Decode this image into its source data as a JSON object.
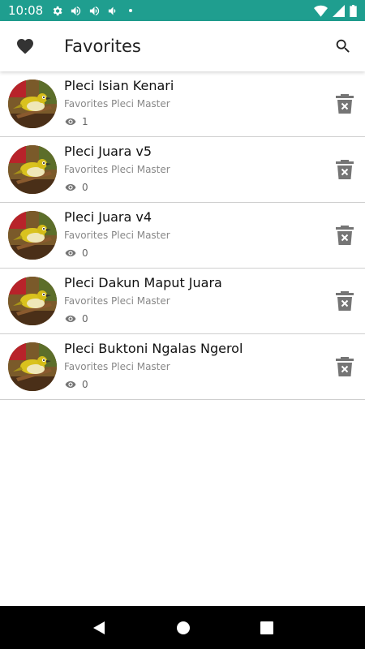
{
  "status_bar": {
    "time": "10:08",
    "left_icons": [
      "settings-icon",
      "volume-icon",
      "volume-icon",
      "volume-icon",
      "dot-icon"
    ],
    "right_icons": [
      "wifi-icon",
      "signal-icon",
      "battery-icon"
    ]
  },
  "app_bar": {
    "title": "Favorites",
    "leading_icon": "heart-icon",
    "action_icon": "search-icon"
  },
  "items": [
    {
      "title": "Pleci Isian Kenari",
      "subtitle": "Favorites Pleci Master",
      "views": "1"
    },
    {
      "title": "Pleci Juara v5",
      "subtitle": "Favorites Pleci Master",
      "views": "0"
    },
    {
      "title": "Pleci Juara v4",
      "subtitle": "Favorites Pleci Master",
      "views": "0"
    },
    {
      "title": "Pleci Dakun Maput Juara",
      "subtitle": "Favorites Pleci Master",
      "views": "0"
    },
    {
      "title": "Pleci Buktoni Ngalas Ngerol",
      "subtitle": "Favorites Pleci Master",
      "views": "0"
    }
  ],
  "nav_bar": {
    "icons": [
      "back-icon",
      "home-icon",
      "recents-icon"
    ]
  },
  "colors": {
    "status_bar": "#1f9e8f",
    "icon_gray": "#757575",
    "divider": "#cfcfcf"
  }
}
